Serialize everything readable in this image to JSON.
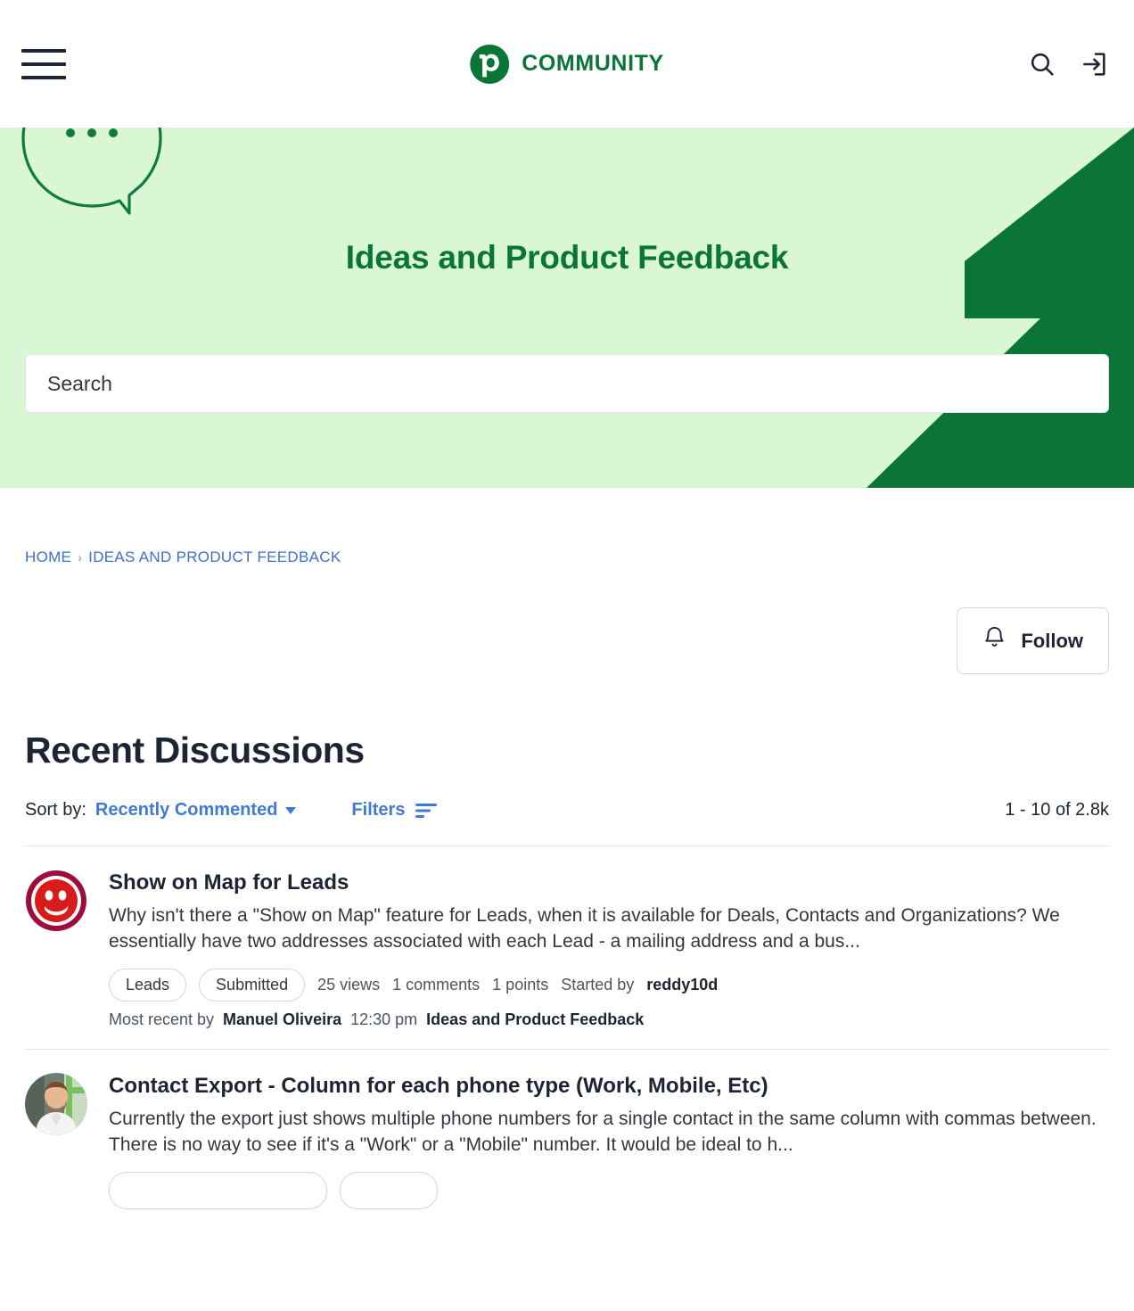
{
  "header": {
    "menu_icon": "hamburger-menu-icon",
    "logo_letter": "p",
    "brand_text": "COMMUNITY",
    "search_icon": "search-icon",
    "signin_icon": "sign-in-icon",
    "brand_color": "#0a7537"
  },
  "hero": {
    "title": "Ideas and Product Feedback",
    "search_placeholder": "Search",
    "search_value": "",
    "bg_color": "#d9f7d5",
    "accent_color": "#0a7537",
    "bubble_icon": "speech-bubble-icon"
  },
  "breadcrumb": {
    "separator": "›",
    "items": [
      {
        "label": "HOME"
      },
      {
        "label": "IDEAS AND PRODUCT FEEDBACK"
      }
    ]
  },
  "follow": {
    "label": "Follow",
    "icon": "bell-icon"
  },
  "main": {
    "section_title": "Recent Discussions",
    "sort_label": "Sort by:",
    "sort_value": "Recently Commented",
    "filters_label": "Filters",
    "filters_icon": "filter-lines-icon",
    "pager": "1 - 10 of 2.8k",
    "link_color": "#3f7ad4"
  },
  "discussions": [
    {
      "avatar": "red-smiley-avatar",
      "title": "Show on Map for Leads",
      "excerpt": "Why isn't there a \"Show on Map\" feature for Leads, when it is available for Deals, Contacts and Organizations? We essentially have two addresses associated with each Lead - a mailing address and a bus...",
      "tags": [
        "Leads",
        "Submitted"
      ],
      "views": "25 views",
      "comments": "1 comments",
      "points": "1 points",
      "started_by_label": "Started by",
      "started_by": "reddy10d",
      "recent_label": "Most recent by",
      "recent_author": "Manuel Oliveira",
      "recent_time": "12:30 pm",
      "category": "Ideas and Product Feedback"
    },
    {
      "avatar": "photo-avatar-man",
      "title": "Contact Export - Column for each phone type (Work, Mobile, Etc)",
      "excerpt": "Currently the export just shows multiple phone numbers for a single contact in the same column with commas between. There is no way to see if it's a \"Work\" or a \"Mobile\" number. It would be ideal to h...",
      "tags": [
        "",
        ""
      ],
      "views": "",
      "comments": "",
      "points": "",
      "started_by_label": "",
      "started_by": "",
      "recent_label": "",
      "recent_author": "",
      "recent_time": "",
      "category": ""
    }
  ]
}
